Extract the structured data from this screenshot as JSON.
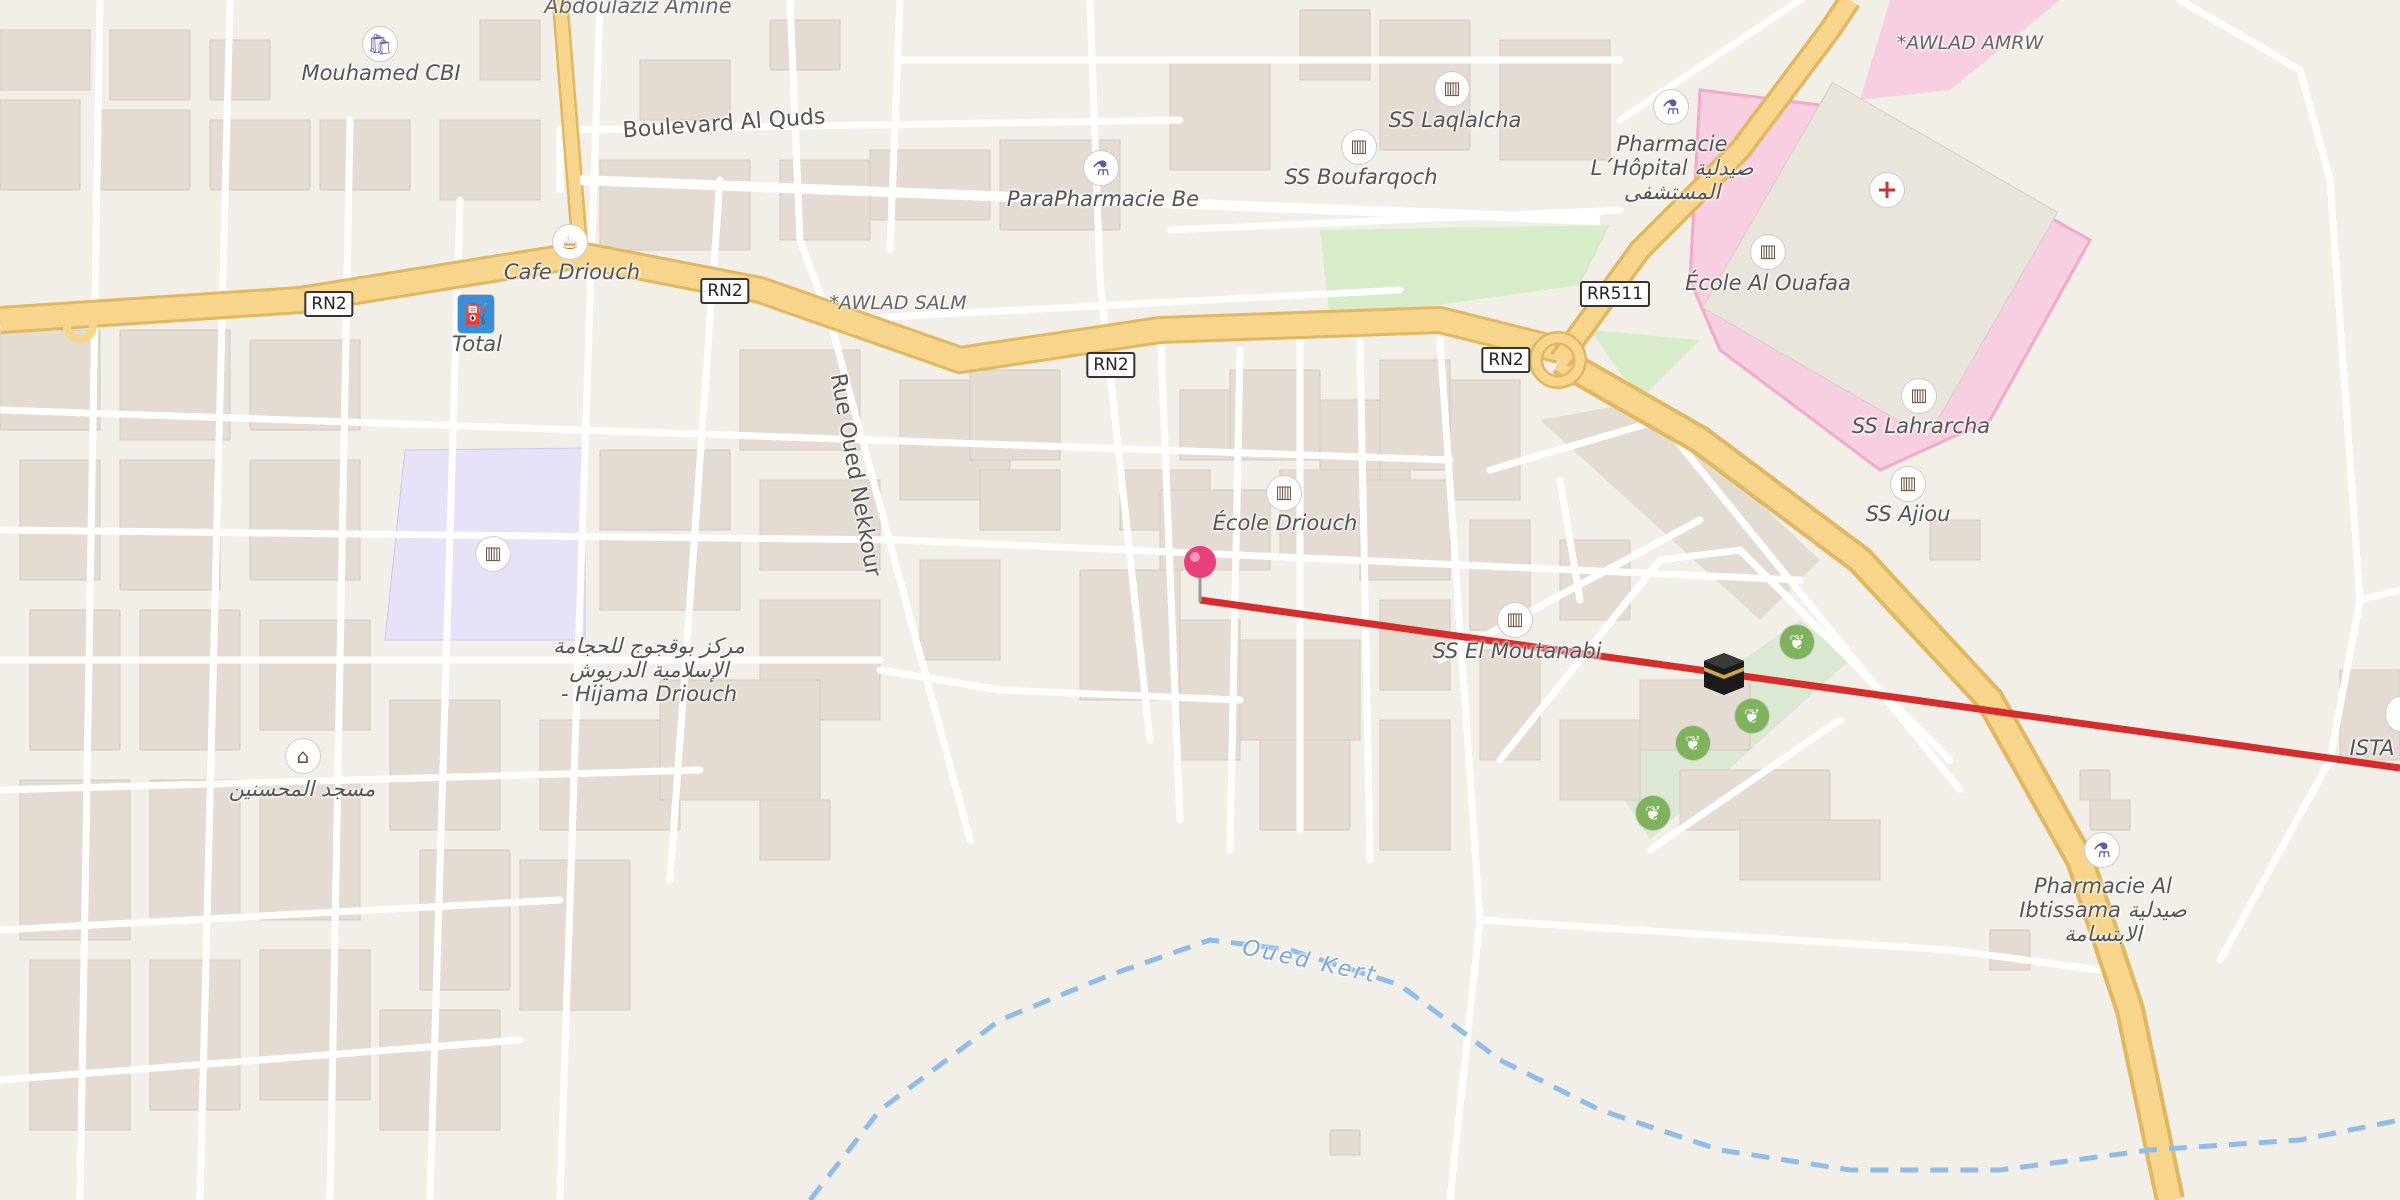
{
  "map": {
    "street_labels": {
      "boulevard_al_quds": "Boulevard Al Quds",
      "rue_oued_nekkour": "Rue Oued Nekkour",
      "abdoulaziz": "Abdoulaziz Amine"
    },
    "place_labels": {
      "awlad_salm": "*AWLAD SALM",
      "awlad_amrw": "*AWLAD AMRW"
    },
    "water_label": "Oued Kert",
    "road_shields": [
      "RN2",
      "RN2",
      "RN2",
      "RN2",
      "RR511"
    ],
    "pois": {
      "mouhamed_cbi": "Mouhamed CBI",
      "cafe_driouch": "Cafe Driouch",
      "total": "Total",
      "parapharmacie": "ParaPharmacie Be",
      "ss_laqlalcha": "SS Laqlalcha",
      "ss_boufarqoch": "SS Boufarqoch",
      "pharmacie_hopital_1": "Pharmacie",
      "pharmacie_hopital_2": "L´Hôpital صيدلية",
      "pharmacie_hopital_3": "المستشفى",
      "ecole_al_ouafaa": "École Al Ouafaa",
      "ss_lahrarcha": "SS Lahrarcha",
      "ss_ajiou": "SS Ajiou",
      "ecole_driouch": "École Driouch",
      "ss_el_moutanabi": "SS El Moutanabi",
      "hijama_1": "مركز بوقجوج للحجامة",
      "hijama_2": "الإسلامية الدريوش",
      "hijama_3": "- Hijama Driouch",
      "mosque": "مسجد المحسنين",
      "ista": "ISTA",
      "pharmacie_ibtissama_1": "Pharmacie Al",
      "pharmacie_ibtissama_2": "Ibtissama صيدلية",
      "pharmacie_ibtissama_3": "الابتسامة"
    },
    "icons": [
      "school-icon",
      "pharmacy-icon",
      "hospital-icon",
      "cafe-icon",
      "shop-icon",
      "mosque-icon",
      "garden-icon",
      "fuel-icon",
      "kaaba-icon",
      "location-pin-icon"
    ],
    "colors": {
      "background": "#f2efe9",
      "building": "#e4dcd2",
      "trunk_road": "#f7d58c",
      "trunk_casing": "#e2b760",
      "hospital_area": "#f8cfe0",
      "school_area": "#e7e2f7",
      "park": "#d7ecc8",
      "water": "#8fbde6",
      "qibla_line": "#d62c2c",
      "pin": "#e8407a"
    }
  }
}
